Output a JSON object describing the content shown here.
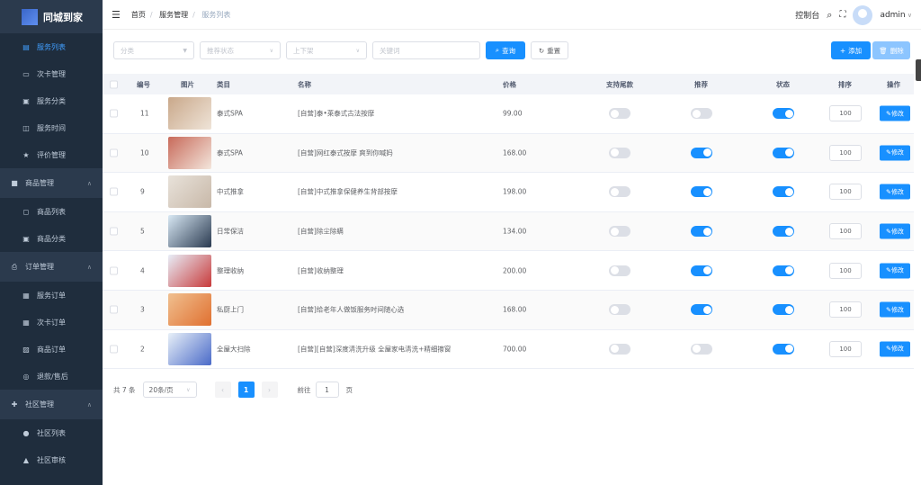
{
  "app": {
    "title": "同城到家"
  },
  "sidebar": {
    "items": [
      {
        "label": "服务列表",
        "icon": "clipboard-icon",
        "active": true,
        "type": "item"
      },
      {
        "label": "次卡管理",
        "icon": "card-icon",
        "type": "item"
      },
      {
        "label": "服务分类",
        "icon": "category-icon",
        "type": "item"
      },
      {
        "label": "服务时间",
        "icon": "clock-tag-icon",
        "type": "item"
      },
      {
        "label": "评价管理",
        "icon": "star-icon",
        "type": "item"
      },
      {
        "label": "商品管理",
        "icon": "bag-icon",
        "type": "group"
      },
      {
        "label": "商品列表",
        "icon": "shopping-bag-icon",
        "type": "item"
      },
      {
        "label": "商品分类",
        "icon": "category-icon",
        "type": "item"
      },
      {
        "label": "订单管理",
        "icon": "printer-icon",
        "type": "group"
      },
      {
        "label": "服务订单",
        "icon": "calendar-icon",
        "type": "item"
      },
      {
        "label": "次卡订单",
        "icon": "grid-icon",
        "type": "item"
      },
      {
        "label": "商品订单",
        "icon": "checklist-icon",
        "type": "item"
      },
      {
        "label": "退款/售后",
        "icon": "refund-icon",
        "type": "item"
      },
      {
        "label": "社区管理",
        "icon": "community-icon",
        "type": "group"
      },
      {
        "label": "社区列表",
        "icon": "user-icon",
        "type": "item"
      },
      {
        "label": "社区审核",
        "icon": "user-check-icon",
        "type": "item"
      }
    ]
  },
  "header": {
    "breadcrumb": [
      "首页",
      "服务管理",
      "服务列表"
    ],
    "console": "控制台",
    "user": "admin"
  },
  "filters": {
    "category_placeholder": "分类",
    "recommend_placeholder": "推荐状态",
    "shelf_placeholder": "上下架",
    "keyword_placeholder": "关键词",
    "search": "查询",
    "reset": "重置",
    "add": "添加",
    "delete": "删除"
  },
  "table": {
    "headers": [
      "编号",
      "图片",
      "类目",
      "名称",
      "价格",
      "支持尾款",
      "推荐",
      "状态",
      "排序",
      "操作"
    ],
    "edit_label": "修改",
    "rows": [
      {
        "id": "11",
        "category": "泰式SPA",
        "name": "[自营]泰•莱泰式古法按摩",
        "price": "99.00",
        "tail": false,
        "recommend": false,
        "status": true,
        "sort": "100",
        "img": [
          "#c9a88a",
          "#efe4d8"
        ]
      },
      {
        "id": "10",
        "category": "泰式SPA",
        "name": "[自营]网红泰式按摩 爽到你喊妈",
        "price": "168.00",
        "tail": false,
        "recommend": true,
        "status": true,
        "sort": "100",
        "img": [
          "#c86a5a",
          "#f3e6dc"
        ]
      },
      {
        "id": "9",
        "category": "中式推拿",
        "name": "[自营]中式推拿保健养生背部按摩",
        "price": "198.00",
        "tail": false,
        "recommend": true,
        "status": true,
        "sort": "100",
        "img": [
          "#e8e2da",
          "#c8b8a8"
        ]
      },
      {
        "id": "5",
        "category": "日常保洁",
        "name": "[自营]除尘除螨",
        "price": "134.00",
        "tail": false,
        "recommend": true,
        "status": true,
        "sort": "100",
        "img": [
          "#d8e8f4",
          "#2a3a50"
        ]
      },
      {
        "id": "4",
        "category": "整理收纳",
        "name": "[自营]收纳整理",
        "price": "200.00",
        "tail": false,
        "recommend": true,
        "status": true,
        "sort": "100",
        "img": [
          "#e8eef8",
          "#c83a3a"
        ]
      },
      {
        "id": "3",
        "category": "私厨上门",
        "name": "[自营]给老年人做饭服务时间随心选",
        "price": "168.00",
        "tail": false,
        "recommend": true,
        "status": true,
        "sort": "100",
        "img": [
          "#f0c090",
          "#e07030"
        ]
      },
      {
        "id": "2",
        "category": "全屋大扫除",
        "name": "[自营][自营]深度清洗升级 全屋家电清洗+精细擦窗",
        "price": "700.00",
        "tail": false,
        "recommend": false,
        "status": true,
        "sort": "100",
        "img": [
          "#e8f0f8",
          "#4a6ac8"
        ]
      }
    ]
  },
  "pagination": {
    "total": "共 7 条",
    "page_size": "20条/页",
    "current": "1",
    "goto_label": "前往",
    "goto_value": "1",
    "page_suffix": "页"
  },
  "colors": {
    "sidebar": "#1f2d3d",
    "accent": "#1890ff"
  }
}
